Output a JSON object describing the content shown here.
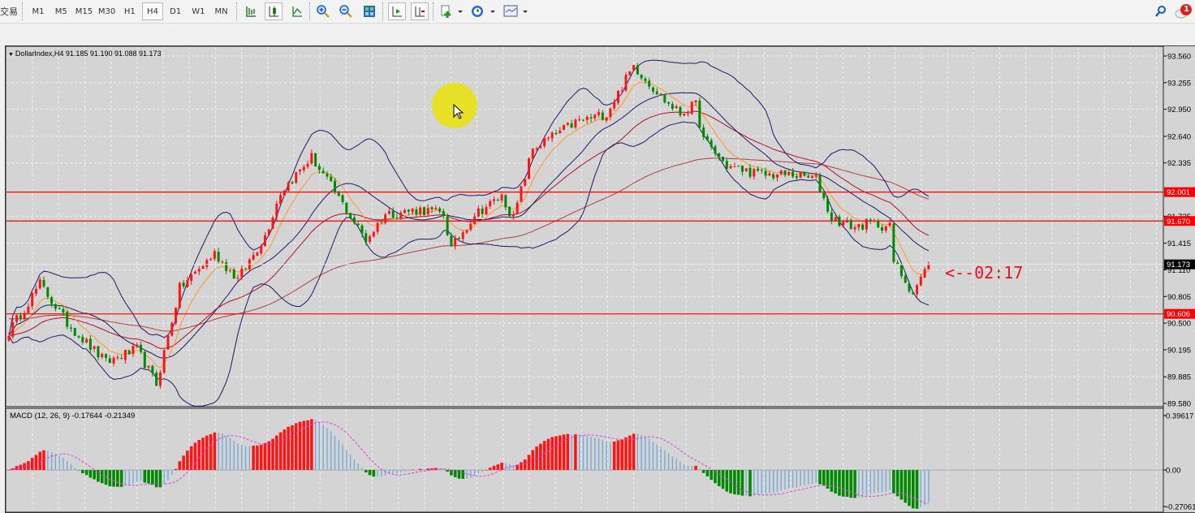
{
  "toolbar": {
    "menu_label": "交易",
    "timeframes": [
      "M1",
      "M5",
      "M15",
      "M30",
      "H1",
      "H4",
      "D1",
      "W1",
      "MN"
    ],
    "active_timeframe": "H4",
    "notification_count": "1"
  },
  "chart": {
    "symbol_label": "DollarIndex,H4  91.185 91.190 91.088 91.173",
    "price_ticks": [
      "93.560",
      "93.255",
      "92.950",
      "92.640",
      "92.335",
      "91.725",
      "91.415",
      "91.110",
      "90.805",
      "90.500",
      "90.195",
      "89.885",
      "89.580"
    ],
    "price_tick_values": [
      93.56,
      93.255,
      92.95,
      92.64,
      92.335,
      91.725,
      91.415,
      91.11,
      90.805,
      90.5,
      90.195,
      89.885,
      89.58
    ],
    "hlines": [
      {
        "value": 92.001,
        "label": "92.001"
      },
      {
        "value": 91.67,
        "label": "91.670"
      },
      {
        "value": 90.606,
        "label": "90.606"
      }
    ],
    "current_price": 91.173,
    "current_price_label": "91.173",
    "bar_timer": "<--02:17",
    "colors": {
      "up": "#ff1414",
      "down": "#008a00",
      "hline": "#ff0000",
      "bands": "#1a1a6e",
      "fast_ma": "#ff9a1e",
      "mid_ma": "#b0102a",
      "slow_ma": "#b04040",
      "signal": "#e040e0",
      "hist_blue": "#6fa8dc"
    },
    "close_path": [
      [
        0,
        90.4
      ],
      [
        8,
        90.95
      ],
      [
        15,
        90.5
      ],
      [
        25,
        90.05
      ],
      [
        33,
        90.2
      ],
      [
        38,
        89.8
      ],
      [
        44,
        90.9
      ],
      [
        53,
        91.3
      ],
      [
        59,
        91.0
      ],
      [
        66,
        91.5
      ],
      [
        70,
        92.0
      ],
      [
        78,
        92.4
      ],
      [
        84,
        92.0
      ],
      [
        92,
        91.45
      ],
      [
        97,
        91.75
      ],
      [
        106,
        91.8
      ],
      [
        112,
        91.75
      ],
      [
        114,
        91.35
      ],
      [
        120,
        91.75
      ],
      [
        127,
        91.95
      ],
      [
        130,
        91.7
      ],
      [
        135,
        92.5
      ],
      [
        146,
        92.8
      ],
      [
        154,
        92.9
      ],
      [
        161,
        93.45
      ],
      [
        169,
        93.05
      ],
      [
        173,
        92.9
      ],
      [
        177,
        93.0
      ],
      [
        179,
        92.6
      ],
      [
        185,
        92.3
      ],
      [
        194,
        92.2
      ],
      [
        202,
        92.2
      ],
      [
        208,
        92.15
      ],
      [
        212,
        91.7
      ],
      [
        218,
        91.6
      ],
      [
        222,
        91.65
      ],
      [
        227,
        91.6
      ],
      [
        228,
        91.2
      ],
      [
        233,
        90.85
      ],
      [
        237,
        91.17
      ]
    ]
  },
  "macd": {
    "label": "MACD (12, 26, 9)  -0.17644 -0.21349",
    "ticks": [
      "0.39617",
      "0.00",
      "-0.27061"
    ]
  }
}
